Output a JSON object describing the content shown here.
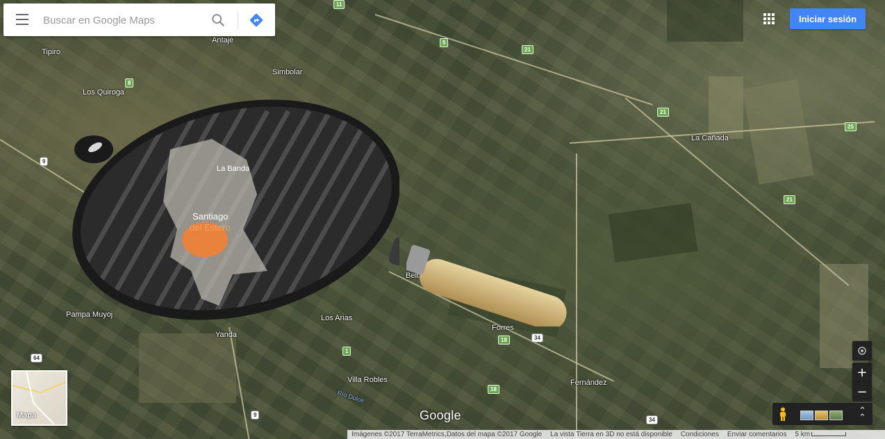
{
  "search": {
    "placeholder": "Buscar en Google Maps"
  },
  "header": {
    "signin_label": "Iniciar sesión"
  },
  "places": {
    "tipiro": "Tipiro",
    "antaje": "Antajé",
    "simbolar": "Simbolar",
    "los_quiroga": "Los Quiroga",
    "la_banda": "La Banda",
    "santiago": "Santiago",
    "del_estero": "del Estero",
    "la_canada": "La Cañada",
    "beltran": "Beltrán",
    "pampa_muyoj": "Pampa Muyoj",
    "los_arias": "Los Arias",
    "yanda": "Yanda",
    "forres": "Forres",
    "villa_robles": "Villa Robles",
    "fernandez": "Fernández",
    "rio_dulce": "Río Dulce"
  },
  "shields": {
    "r11": "11",
    "r5": "5",
    "r21a": "21",
    "r21b": "21",
    "r21c": "21",
    "r25": "25",
    "r8": "8",
    "r9a": "9",
    "r9b": "9",
    "r9c": "9",
    "r18a": "18",
    "r18b": "18",
    "r34a": "34",
    "r34b": "34",
    "r1": "1",
    "r64": "64"
  },
  "minimap": {
    "label": "Mapa"
  },
  "logo": "Google",
  "footer": {
    "imagery": "Imágenes ©2017 TerraMetrics,Datos del mapa ©2017 Google",
    "earth_3d": "La vista Tierra en 3D no está disponible",
    "terms": "Condiciones",
    "feedback": "Enviar comentarios",
    "scale": "5 km"
  },
  "controls": {
    "zoom_in": "+",
    "zoom_out": "−"
  },
  "colors": {
    "accent": "#4285f4",
    "route_shield": "#6aa84f",
    "egg_yolk": "#e8823c"
  }
}
